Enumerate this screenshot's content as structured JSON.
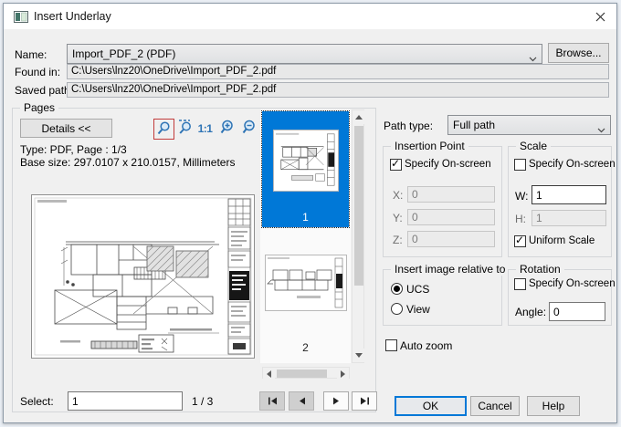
{
  "window": {
    "title": "Insert Underlay"
  },
  "form": {
    "name_label": "Name:",
    "name_value": "Import_PDF_2 (PDF)",
    "browse_button": "Browse...",
    "found_in_label": "Found in:",
    "found_in_value": "C:\\Users\\lnz20\\OneDrive\\Import_PDF_2.pdf",
    "saved_path_label": "Saved path:",
    "saved_path_value": "C:\\Users\\lnz20\\OneDrive\\Import_PDF_2.pdf",
    "path_type_label": "Path type:",
    "path_type_value": "Full path"
  },
  "pages": {
    "group_label": "Pages",
    "details_button": "Details <<",
    "actual_size_label": "1:1",
    "type_line": "Type: PDF, Page : 1/3",
    "base_size_line": "Base size: 297.0107 x 210.0157, Millimeters",
    "thumbnails": [
      {
        "label": "1",
        "selected": true
      },
      {
        "label": "2",
        "selected": false
      }
    ],
    "select_label": "Select:",
    "select_value": "1",
    "page_indicator": "1 / 3"
  },
  "insertion_point": {
    "group_label": "Insertion Point",
    "specify_label": "Specify On-screen",
    "specify_checked": true,
    "x_label": "X:",
    "x_value": "0",
    "y_label": "Y:",
    "y_value": "0",
    "z_label": "Z:",
    "z_value": "0"
  },
  "scale": {
    "group_label": "Scale",
    "specify_label": "Specify On-screen",
    "specify_checked": false,
    "w_label": "W:",
    "w_value": "1",
    "h_label": "H:",
    "h_value": "1",
    "uniform_label": "Uniform Scale",
    "uniform_checked": true
  },
  "relative": {
    "group_label": "Insert image relative to",
    "ucs_label": "UCS",
    "view_label": "View",
    "selected": "UCS"
  },
  "rotation": {
    "group_label": "Rotation",
    "specify_label": "Specify On-screen",
    "specify_checked": false,
    "angle_label": "Angle:",
    "angle_value": "0"
  },
  "auto_zoom_label": "Auto zoom",
  "footer": {
    "ok": "OK",
    "cancel": "Cancel",
    "help": "Help"
  },
  "colors": {
    "selection_blue": "#0078d7",
    "icon_blue": "#2e74b5",
    "zoom_window_outline": "#c23b3b",
    "dialog_bg": "#f0f0f0",
    "titlebar_bg": "#ffffff"
  }
}
